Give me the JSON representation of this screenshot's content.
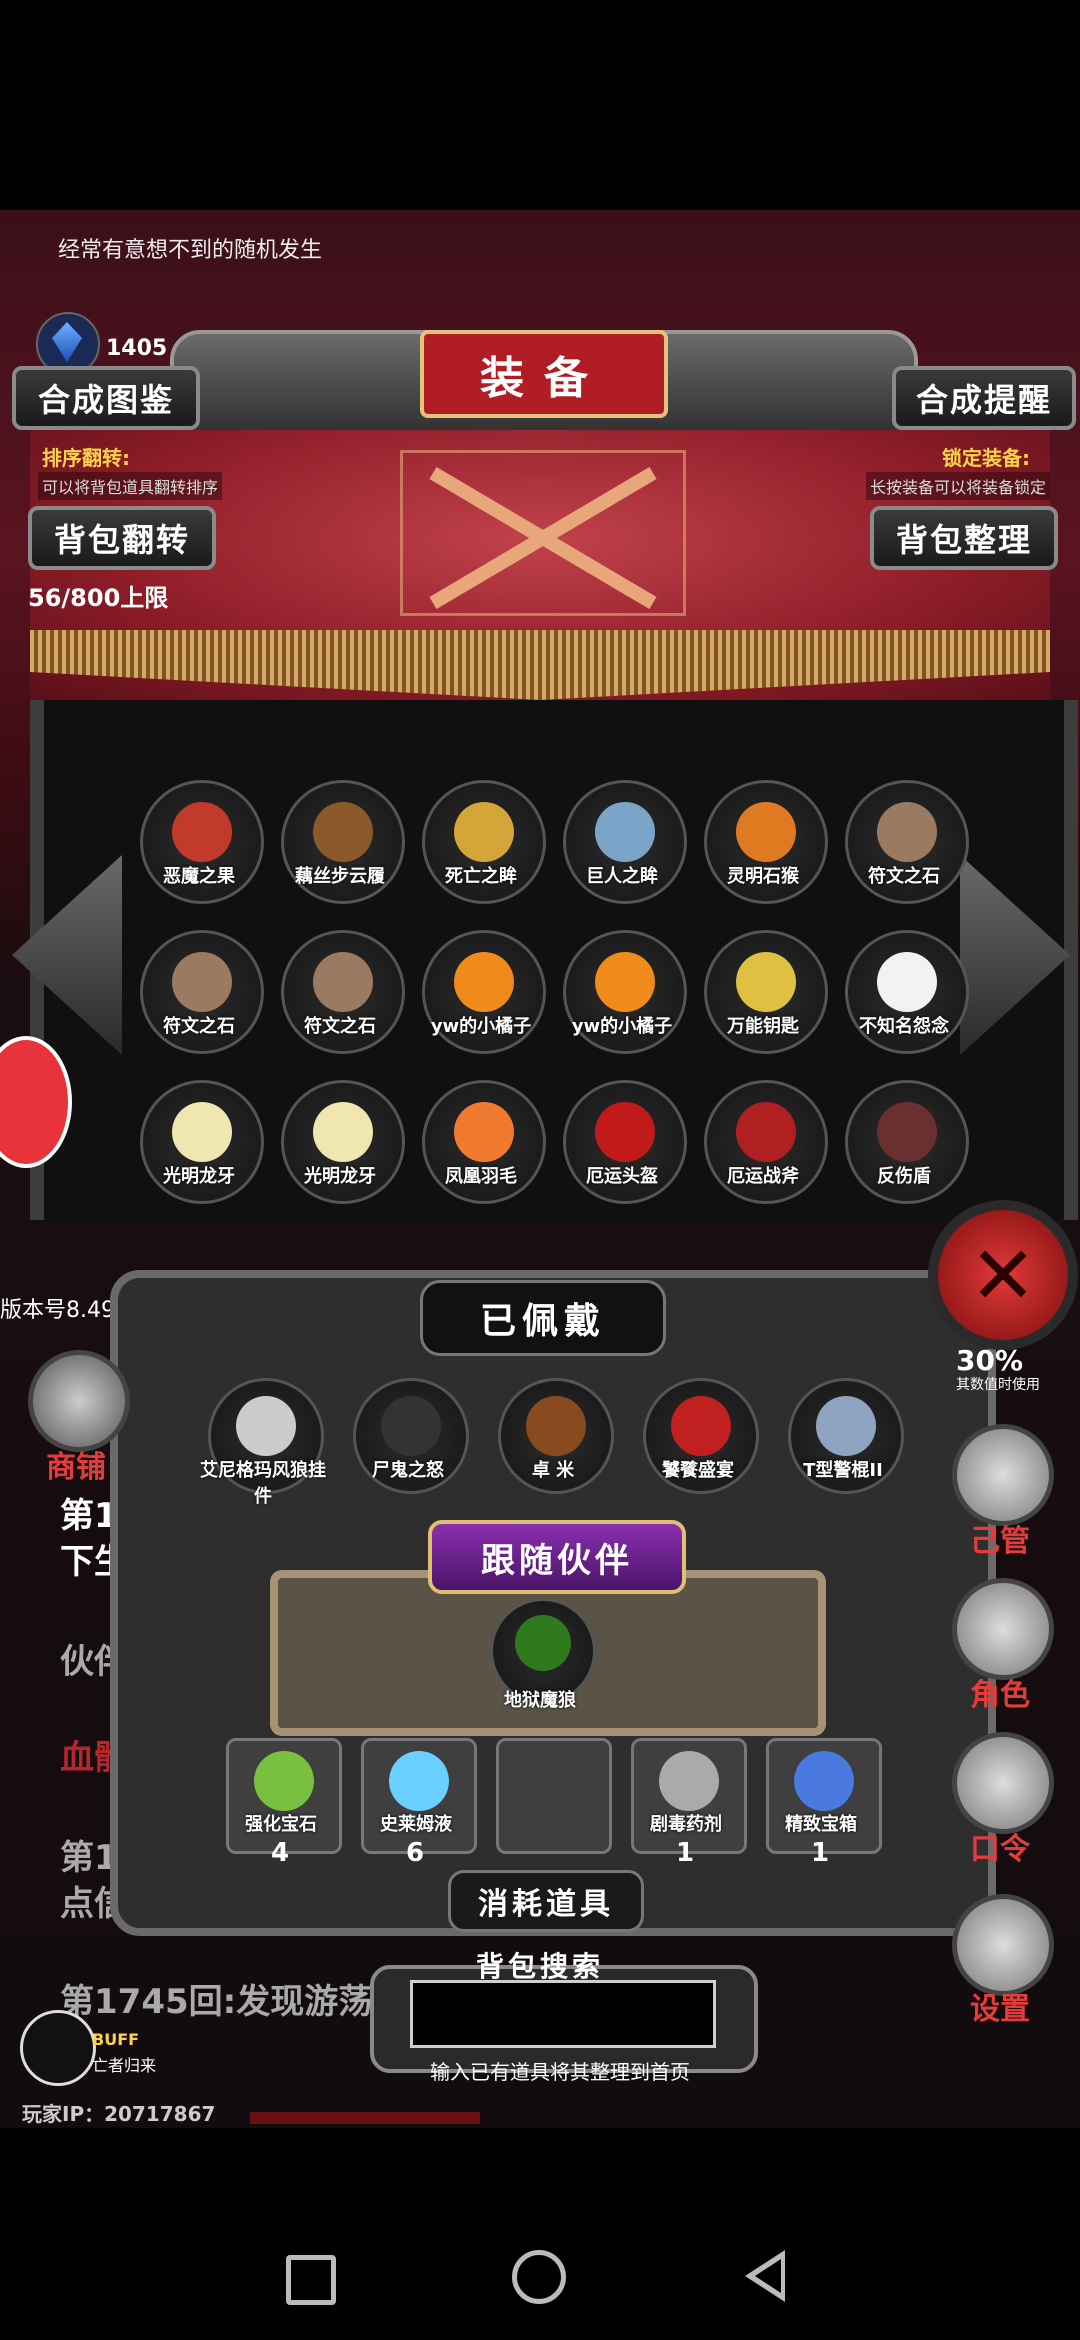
{
  "header": {
    "tip": "经常有意想不到的随机发生",
    "gem_count": "1405",
    "title": "装备"
  },
  "buttons": {
    "synth_book": "合成图鉴",
    "synth_remind": "合成提醒",
    "bag_flip": "背包翻转",
    "bag_sort": "背包整理"
  },
  "notes": {
    "sort_flip_title": "排序翻转:",
    "sort_flip_desc": "可以将背包道具翻转排序",
    "lock_title": "锁定装备:",
    "lock_desc": "长按装备可以将装备锁定"
  },
  "capacity": "56/800上限",
  "version": "版本号8.49",
  "items": [
    {
      "name": "恶魔之果",
      "icon": "demon-fruit-icon"
    },
    {
      "name": "藕丝步云履",
      "icon": "boots-icon"
    },
    {
      "name": "死亡之眸",
      "icon": "death-eye-icon"
    },
    {
      "name": "巨人之眸",
      "icon": "giant-eye-icon"
    },
    {
      "name": "灵明石猴",
      "icon": "stone-monkey-icon"
    },
    {
      "name": "符文之石",
      "icon": "rune-stone-icon"
    },
    {
      "name": "符文之石",
      "icon": "rune-stone-icon"
    },
    {
      "name": "符文之石",
      "icon": "rune-stone-icon"
    },
    {
      "name": "yw的小橘子",
      "icon": "orange-icon"
    },
    {
      "name": "yw的小橘子",
      "icon": "orange-icon"
    },
    {
      "name": "万能钥匙",
      "icon": "key-icon"
    },
    {
      "name": "不知名怨念",
      "icon": "ghost-icon"
    },
    {
      "name": "光明龙牙",
      "icon": "dragon-tooth-icon"
    },
    {
      "name": "光明龙牙",
      "icon": "dragon-tooth-icon"
    },
    {
      "name": "凤凰羽毛",
      "icon": "feather-icon"
    },
    {
      "name": "厄运头盔",
      "icon": "helmet-icon"
    },
    {
      "name": "厄运战斧",
      "icon": "axe-icon"
    },
    {
      "name": "反伤盾",
      "icon": "spike-shield-icon"
    }
  ],
  "equipped": {
    "title": "已佩戴",
    "items": [
      {
        "name": "艾尼格玛风狼挂件",
        "icon": "wolf-pendant-icon"
      },
      {
        "name": "尸鬼之怒",
        "icon": "claw-icon"
      },
      {
        "name": "卓 米",
        "icon": "whip-icon"
      },
      {
        "name": "饕餮盛宴",
        "icon": "demon-mask-icon"
      },
      {
        "name": "T型警棍II",
        "icon": "baton-icon"
      }
    ]
  },
  "companion": {
    "title": "跟随伙伴",
    "name": "地狱魔狼"
  },
  "consumables": {
    "title": "消耗道具",
    "items": [
      {
        "name": "强化宝石",
        "count": "4",
        "icon": "green-gem-icon"
      },
      {
        "name": "史莱姆液",
        "count": "6",
        "icon": "potion-icon"
      },
      {
        "name": "",
        "count": "",
        "icon": ""
      },
      {
        "name": "剧毒药剂",
        "count": "1",
        "icon": "poison-icon"
      },
      {
        "name": "精致宝箱",
        "count": "1",
        "icon": "chest-icon"
      }
    ]
  },
  "search": {
    "title": "背包搜索",
    "hint": "输入已有道具将其整理到首页"
  },
  "side": {
    "shop": "商铺",
    "manage": "己管",
    "role": "角色",
    "code": "口令",
    "settings": "设置",
    "pct": "30%",
    "pct_note": "其数值时使用"
  },
  "story": {
    "l1": "第1",
    "l2": "下生",
    "l3": "伙伴",
    "l4": "血骷",
    "l5": "第1",
    "l6": "点信",
    "l7": "第1745回:发现游荡"
  },
  "buff": {
    "label": "BUFF",
    "desc": "亡者归来"
  },
  "player_ip": "玩家IP：20717867",
  "colors": {
    "accent_red": "#b01d24",
    "gold": "#e8c27a",
    "close_red": "#e23a3a"
  }
}
